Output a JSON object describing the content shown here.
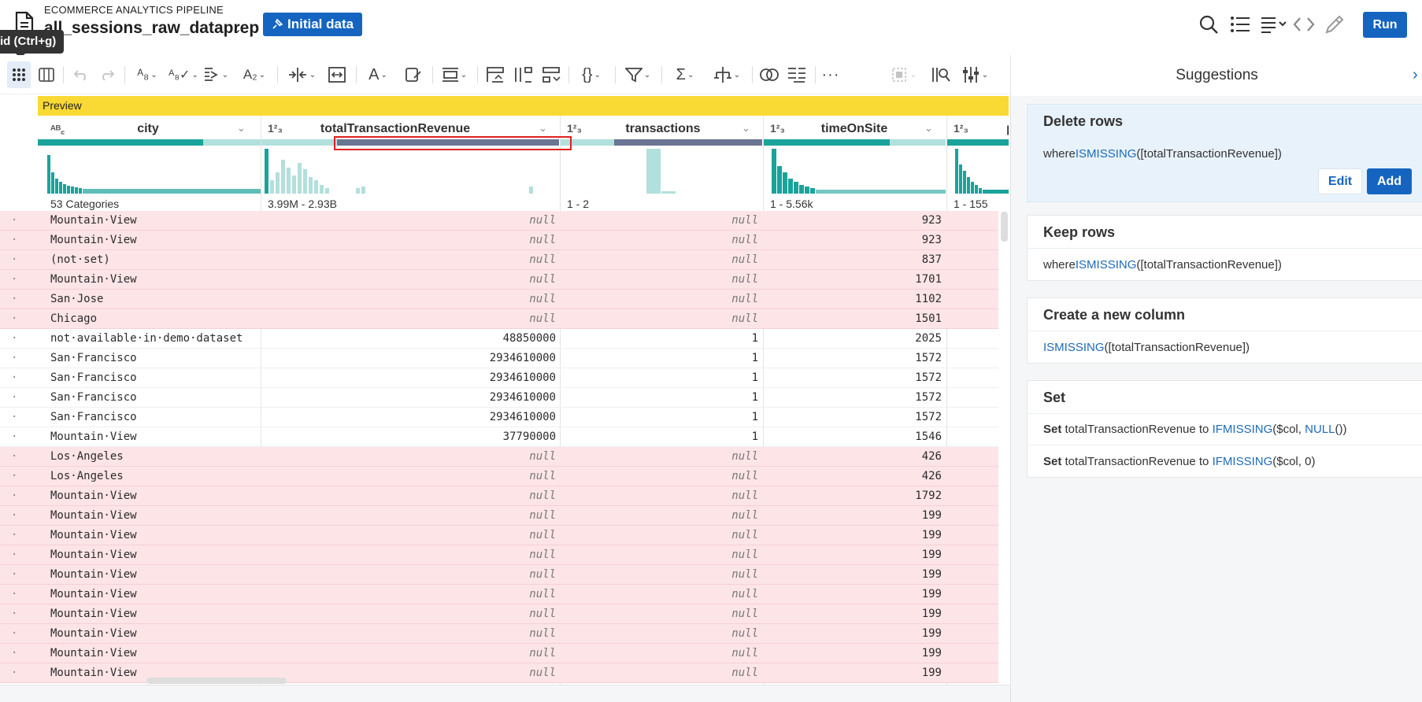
{
  "header": {
    "pipeline_label": "ECOMMERCE ANALYTICS PIPELINE",
    "dataset_title": "all_sessions_raw_dataprep",
    "initial_data_label": "Initial data",
    "run_label": "Run",
    "tooltip": "id (Ctrl+g)"
  },
  "grid": {
    "preview_label": "Preview",
    "columns": [
      {
        "type": "ABC",
        "name": "city",
        "range": "53 Categories"
      },
      {
        "type": "123",
        "name": "totalTransactionRevenue",
        "range": "3.99M - 2.93B"
      },
      {
        "type": "123",
        "name": "transactions",
        "range": "1 - 2"
      },
      {
        "type": "123",
        "name": "timeOnSite",
        "range": "1 - 5.56k"
      },
      {
        "type": "123",
        "name": "p",
        "range": "1 - 155"
      }
    ],
    "rows": [
      {
        "city": "Mountain·View",
        "revenue": "null",
        "transactions": "null",
        "timeOnSite": "923",
        "missing": true
      },
      {
        "city": "Mountain·View",
        "revenue": "null",
        "transactions": "null",
        "timeOnSite": "923",
        "missing": true
      },
      {
        "city": "(not·set)",
        "revenue": "null",
        "transactions": "null",
        "timeOnSite": "837",
        "missing": true
      },
      {
        "city": "Mountain·View",
        "revenue": "null",
        "transactions": "null",
        "timeOnSite": "1701",
        "missing": true
      },
      {
        "city": "San·Jose",
        "revenue": "null",
        "transactions": "null",
        "timeOnSite": "1102",
        "missing": true
      },
      {
        "city": "Chicago",
        "revenue": "null",
        "transactions": "null",
        "timeOnSite": "1501",
        "missing": true
      },
      {
        "city": "not·available·in·demo·dataset",
        "revenue": "48850000",
        "transactions": "1",
        "timeOnSite": "2025",
        "missing": false
      },
      {
        "city": "San·Francisco",
        "revenue": "2934610000",
        "transactions": "1",
        "timeOnSite": "1572",
        "missing": false
      },
      {
        "city": "San·Francisco",
        "revenue": "2934610000",
        "transactions": "1",
        "timeOnSite": "1572",
        "missing": false
      },
      {
        "city": "San·Francisco",
        "revenue": "2934610000",
        "transactions": "1",
        "timeOnSite": "1572",
        "missing": false
      },
      {
        "city": "San·Francisco",
        "revenue": "2934610000",
        "transactions": "1",
        "timeOnSite": "1572",
        "missing": false
      },
      {
        "city": "Mountain·View",
        "revenue": "37790000",
        "transactions": "1",
        "timeOnSite": "1546",
        "missing": false
      },
      {
        "city": "Los·Angeles",
        "revenue": "null",
        "transactions": "null",
        "timeOnSite": "426",
        "missing": true
      },
      {
        "city": "Los·Angeles",
        "revenue": "null",
        "transactions": "null",
        "timeOnSite": "426",
        "missing": true
      },
      {
        "city": "Mountain·View",
        "revenue": "null",
        "transactions": "null",
        "timeOnSite": "1792",
        "missing": true
      },
      {
        "city": "Mountain·View",
        "revenue": "null",
        "transactions": "null",
        "timeOnSite": "199",
        "missing": true
      },
      {
        "city": "Mountain·View",
        "revenue": "null",
        "transactions": "null",
        "timeOnSite": "199",
        "missing": true
      },
      {
        "city": "Mountain·View",
        "revenue": "null",
        "transactions": "null",
        "timeOnSite": "199",
        "missing": true
      },
      {
        "city": "Mountain·View",
        "revenue": "null",
        "transactions": "null",
        "timeOnSite": "199",
        "missing": true
      },
      {
        "city": "Mountain·View",
        "revenue": "null",
        "transactions": "null",
        "timeOnSite": "199",
        "missing": true
      },
      {
        "city": "Mountain·View",
        "revenue": "null",
        "transactions": "null",
        "timeOnSite": "199",
        "missing": true
      },
      {
        "city": "Mountain·View",
        "revenue": "null",
        "transactions": "null",
        "timeOnSite": "199",
        "missing": true
      },
      {
        "city": "Mountain·View",
        "revenue": "null",
        "transactions": "null",
        "timeOnSite": "199",
        "missing": true
      },
      {
        "city": "Mountain·View",
        "revenue": "null",
        "transactions": "null",
        "timeOnSite": "199",
        "missing": true
      }
    ]
  },
  "suggestions": {
    "title": "Suggestions",
    "delete_rows": {
      "title": "Delete rows",
      "prefix": "where ",
      "fn": "ISMISSING",
      "args": "([totalTransactionRevenue])",
      "edit_label": "Edit",
      "add_label": "Add"
    },
    "keep_rows": {
      "title": "Keep rows",
      "prefix": "where ",
      "fn": "ISMISSING",
      "args": "([totalTransactionRevenue])"
    },
    "new_column": {
      "title": "Create a new column",
      "fn": "ISMISSING",
      "args": "([totalTransactionRevenue])"
    },
    "set": {
      "title": "Set",
      "line1": {
        "kw": "Set",
        "text": " totalTransactionRevenue to ",
        "fn": "IFMISSING",
        "mid": "($col, ",
        "fn2": "NULL",
        "end": "())"
      },
      "line2": {
        "kw": "Set",
        "text": " totalTransactionRevenue to ",
        "fn": "IFMISSING",
        "end": "($col, 0)"
      }
    }
  },
  "colors": {
    "accent": "#1565c0",
    "missing_row": "#fde4e7",
    "preview_bar": "#f9d934",
    "hist_teal": "#1aa39a",
    "hist_light": "#b2e0dc",
    "quality_dark": "#6b7594"
  }
}
